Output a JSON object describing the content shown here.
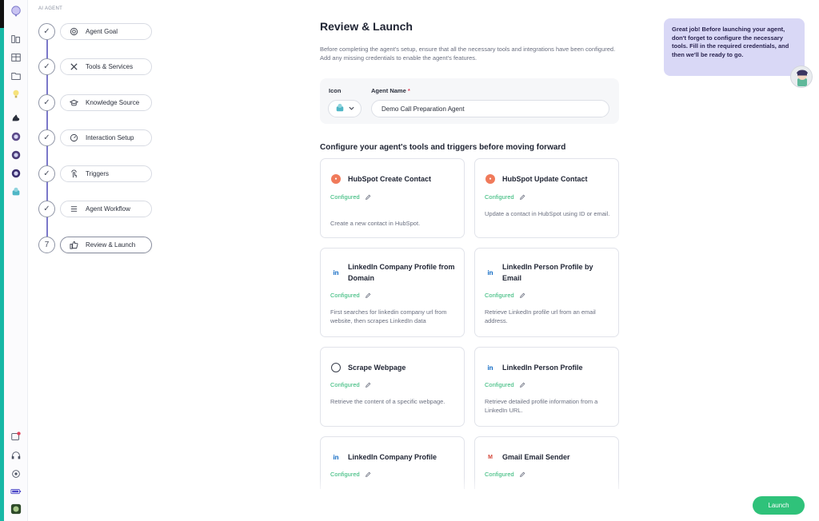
{
  "sidebar_label": "AI AGENT",
  "steps": [
    {
      "num": "",
      "label": "Agent Goal",
      "icon": "target-icon",
      "done": true
    },
    {
      "num": "",
      "label": "Tools & Services",
      "icon": "tools-icon",
      "done": true
    },
    {
      "num": "",
      "label": "Knowledge Source",
      "icon": "graduation-cap-icon",
      "done": true
    },
    {
      "num": "",
      "label": "Interaction Setup",
      "icon": "gauge-icon",
      "done": true
    },
    {
      "num": "",
      "label": "Triggers",
      "icon": "touch-icon",
      "done": true
    },
    {
      "num": "",
      "label": "Agent Workflow",
      "icon": "list-icon",
      "done": true
    },
    {
      "num": "7",
      "label": "Review & Launch",
      "icon": "thumbs-up-icon",
      "done": false
    }
  ],
  "main": {
    "title": "Review & Launch",
    "description": "Before completing the agent's setup, ensure that all the necessary tools and integrations have been configured. Add any missing credentials to enable the agent's features.",
    "icon_label": "Icon",
    "agent_name_label": "Agent Name",
    "required_mark": "*",
    "agent_name_value": "Demo Call Preparation Agent",
    "section_title": "Configure your agent's tools and triggers before moving forward",
    "configured_label": "Configured"
  },
  "tools": [
    {
      "name": "HubSpot Create Contact",
      "icon": "hubspot-icon",
      "glyph": "●",
      "status": "Configured",
      "desc": "Create a new contact in HubSpot."
    },
    {
      "name": "HubSpot Update Contact",
      "icon": "hubspot-icon",
      "glyph": "●",
      "status": "Configured",
      "desc": "Update a contact in HubSpot using ID or email."
    },
    {
      "name": "LinkedIn Company Profile from Domain",
      "icon": "linkedin-icon",
      "glyph": "in",
      "status": "Configured",
      "desc": "First searches for linkedin company url from website, then scrapes LinkedIn data"
    },
    {
      "name": "LinkedIn Person Profile by Email",
      "icon": "linkedin-icon",
      "glyph": "in",
      "status": "Configured",
      "desc": "Retrieve LinkedIn profile url from an email address."
    },
    {
      "name": "Scrape Webpage",
      "icon": "globe-icon",
      "glyph": "",
      "status": "Configured",
      "desc": "Retrieve the content of a specific webpage."
    },
    {
      "name": "LinkedIn Person Profile",
      "icon": "linkedin-icon",
      "glyph": "in",
      "status": "Configured",
      "desc": "Retrieve detailed profile information from a LinkedIn URL."
    },
    {
      "name": "LinkedIn Company Profile",
      "icon": "linkedin-icon",
      "glyph": "in",
      "status": "Configured",
      "desc": ""
    },
    {
      "name": "Gmail Email Sender",
      "icon": "gmail-icon",
      "glyph": "M",
      "status": "Configured",
      "desc": ""
    }
  ],
  "helper": {
    "message": "Great job! Before launching your agent, don't forget to configure the necessary tools. Fill in the required credentials, and then we'll be ready to go."
  },
  "launch_label": "Launch",
  "colors": {
    "accent": "#7b78c9",
    "configured": "#2bb673",
    "launch": "#2fc27a",
    "bubble": "#d9d8f6",
    "required": "#e0425a"
  }
}
